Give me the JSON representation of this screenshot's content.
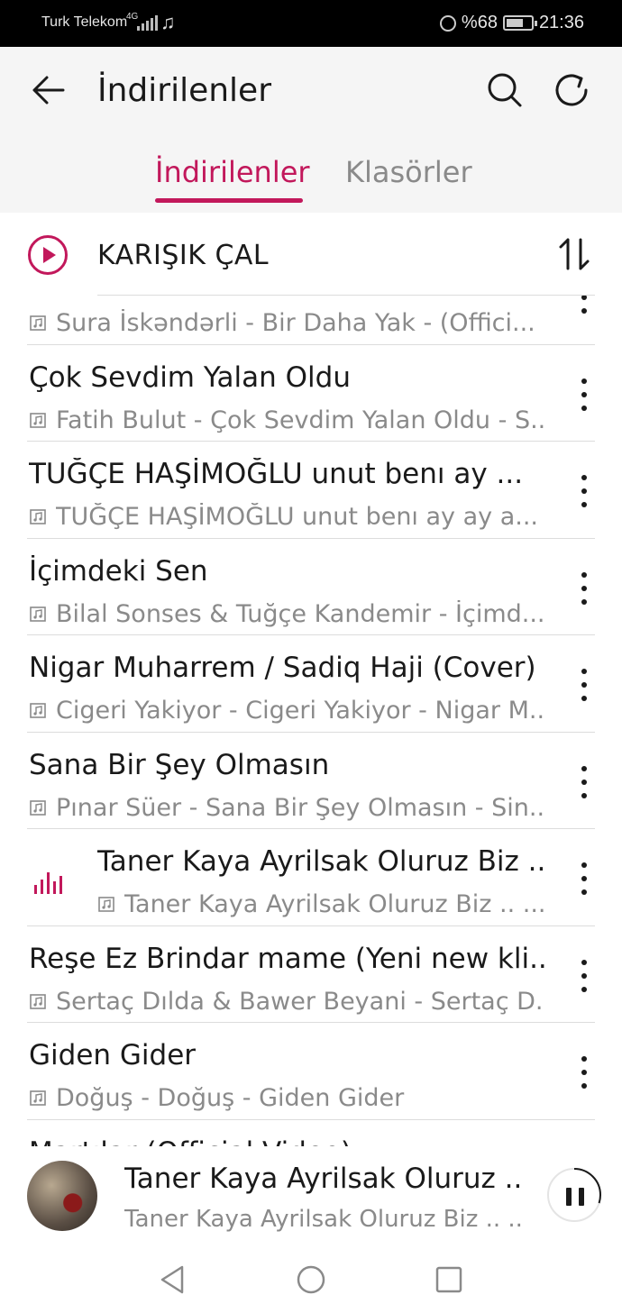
{
  "status_bar": {
    "carrier": "Turk Telekom",
    "network": "4G",
    "battery": "%68",
    "battery_level": 0.68,
    "time": "21:36"
  },
  "header": {
    "title": "İndirilenler",
    "back_icon": "arrow-left-icon",
    "search_icon": "search-icon",
    "refresh_icon": "refresh-icon"
  },
  "tabs": [
    {
      "label": "İndirilenler",
      "active": true
    },
    {
      "label": "Klasörler",
      "active": false
    }
  ],
  "shuffle": {
    "label": "KARIŞIK ÇAL",
    "icon": "play-circle-icon",
    "sort_icon": "sort-icon"
  },
  "songs": [
    {
      "title": "",
      "subtitle": "Sura İskəndərli - Bir Daha Yak -  (Offici...",
      "playing": false
    },
    {
      "title": "Çok Sevdim Yalan Oldu",
      "subtitle": "Fatih Bulut - Çok Sevdim Yalan Oldu - S...",
      "playing": false
    },
    {
      "title": "TUĞÇE HAŞİMOĞLU  unut benı ay ...",
      "subtitle": "TUĞÇE HAŞİMOĞLU  unut benı ay ay a...",
      "playing": false
    },
    {
      "title": "İçimdeki Sen",
      "subtitle": "Bilal Sonses & Tuğçe Kandemir - İçimd...",
      "playing": false
    },
    {
      "title": "Nigar Muharrem / Sadiq Haji (Cover)",
      "subtitle": "Cigeri Yakiyor - Cigeri Yakiyor - Nigar M...",
      "playing": false
    },
    {
      "title": "Sana Bir Şey Olmasın",
      "subtitle": "Pınar Süer - Sana Bir Şey Olmasın - Sin...",
      "playing": false
    },
    {
      "title": "Taner Kaya Ayrilsak Oluruz Biz ...",
      "subtitle": "Taner Kaya Ayrilsak Oluruz Biz .. ...",
      "playing": true
    },
    {
      "title": "Reşe Ez Brindar mame (Yeni new kli...",
      "subtitle": "Sertaç Dılda & Bawer Beyani - Sertaç D...",
      "playing": false
    },
    {
      "title": "Giden Gider",
      "subtitle": "Doğuş - Doğuş - Giden Gider",
      "playing": false
    },
    {
      "title": "Martılar (Official Video)",
      "subtitle": "",
      "playing": false
    }
  ],
  "mini_player": {
    "title": "Taner Kaya Ayrilsak Oluruz ...",
    "subtitle": "Taner Kaya Ayrilsak Oluruz Biz .. ...",
    "progress": 0.3,
    "pause_icon": "pause-icon"
  },
  "nav": {
    "back_icon": "nav-back-icon",
    "home_icon": "nav-home-icon",
    "recents_icon": "nav-recents-icon"
  },
  "colors": {
    "accent": "#c2185b",
    "text_primary": "#1a1a1a",
    "text_secondary": "#8a8a8a",
    "header_bg": "#f5f5f5"
  }
}
